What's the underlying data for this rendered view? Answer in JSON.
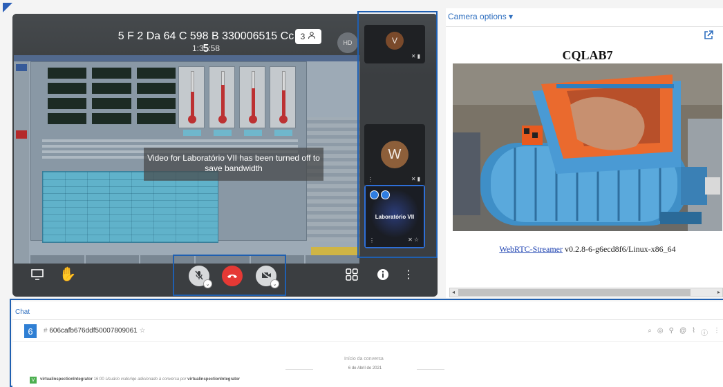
{
  "meeting": {
    "title": "5 F 2 Da 64 C 598 B 330006515 Cc 5",
    "timer": "1:35:58",
    "participant_count": "3",
    "avatar_initials": "HD",
    "notice": "Video for Laboratório VII has been turned off to save bandwidth",
    "participants": [
      {
        "initial": "V"
      },
      {
        "initial": "W"
      },
      {
        "name": "Laboratório VII"
      }
    ]
  },
  "camera": {
    "options_label": "Camera options ▾",
    "title": "CQLAB7",
    "link_text": "WebRTC-Streamer",
    "version": " v0.2.8-6-g6ecd8f6/Linux-x86_64"
  },
  "chat": {
    "label": "Chat",
    "badge": "6",
    "room": "606cafb676ddf50007809061",
    "start": "Início da conversa",
    "date": "6 de Abril de 2021",
    "avatar": "V",
    "user": "virtualinspectionIntegrator",
    "time": "16:00",
    "message": "Usuário vsdoriqe adicionado à conversa por",
    "by": "virtualinspectionIntegrator"
  },
  "colors": {
    "highlight": "#1f5fb0",
    "link": "#2f6fbf",
    "hangup": "#e53935"
  }
}
